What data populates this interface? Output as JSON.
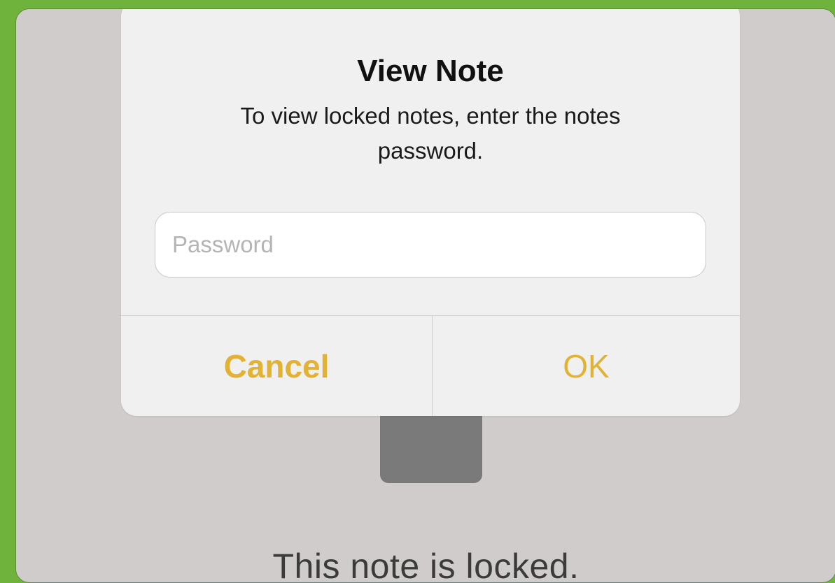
{
  "alert": {
    "title": "View Note",
    "message": "To view locked notes, enter the notes password.",
    "password_placeholder": "Password",
    "password_value": "",
    "cancel_label": "Cancel",
    "ok_label": "OK"
  },
  "background": {
    "locked_message": "This note is locked."
  },
  "colors": {
    "accent": "#e1b234",
    "frame": "#6fb33c",
    "screen_bg": "#d0cccb",
    "alert_bg": "#f1f0f0"
  },
  "icons": {
    "lock": "lock-icon"
  }
}
